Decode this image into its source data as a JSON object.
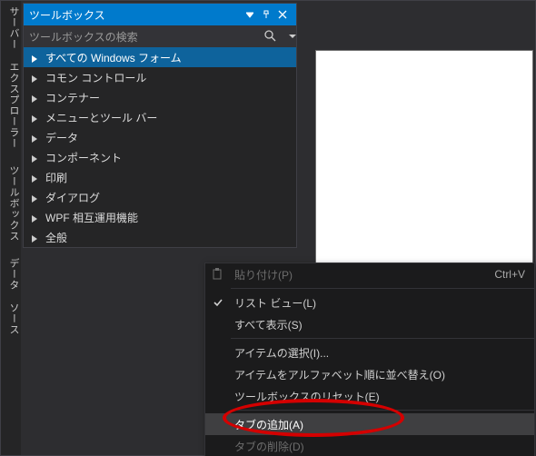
{
  "vertical_tabs": {
    "server_explorer": "サーバー エクスプローラー",
    "toolbox": "ツールボックス",
    "data_sources": "データ ソース"
  },
  "panel": {
    "title": "ツールボックス",
    "search_placeholder": "ツールボックスの検索"
  },
  "tree": {
    "items": [
      {
        "label": "すべての Windows フォーム",
        "selected": true
      },
      {
        "label": "コモン コントロール"
      },
      {
        "label": "コンテナー"
      },
      {
        "label": "メニューとツール バー"
      },
      {
        "label": "データ"
      },
      {
        "label": "コンポーネント"
      },
      {
        "label": "印刷"
      },
      {
        "label": "ダイアログ"
      },
      {
        "label": "WPF 相互運用機能"
      },
      {
        "label": "全般"
      }
    ]
  },
  "context_menu": {
    "paste": {
      "label": "貼り付け(P)",
      "shortcut": "Ctrl+V",
      "enabled": false
    },
    "list_view": {
      "label": "リスト ビュー(L)",
      "checked": true
    },
    "show_all": {
      "label": "すべて表示(S)"
    },
    "choose_items": {
      "label": "アイテムの選択(I)..."
    },
    "sort_alpha": {
      "label": "アイテムをアルファベット順に並べ替え(O)"
    },
    "reset": {
      "label": "ツールボックスのリセット(E)"
    },
    "add_tab": {
      "label": "タブの追加(A)",
      "highlighted": true
    },
    "delete_tab": {
      "label": "タブの削除(D)",
      "enabled": false
    }
  }
}
